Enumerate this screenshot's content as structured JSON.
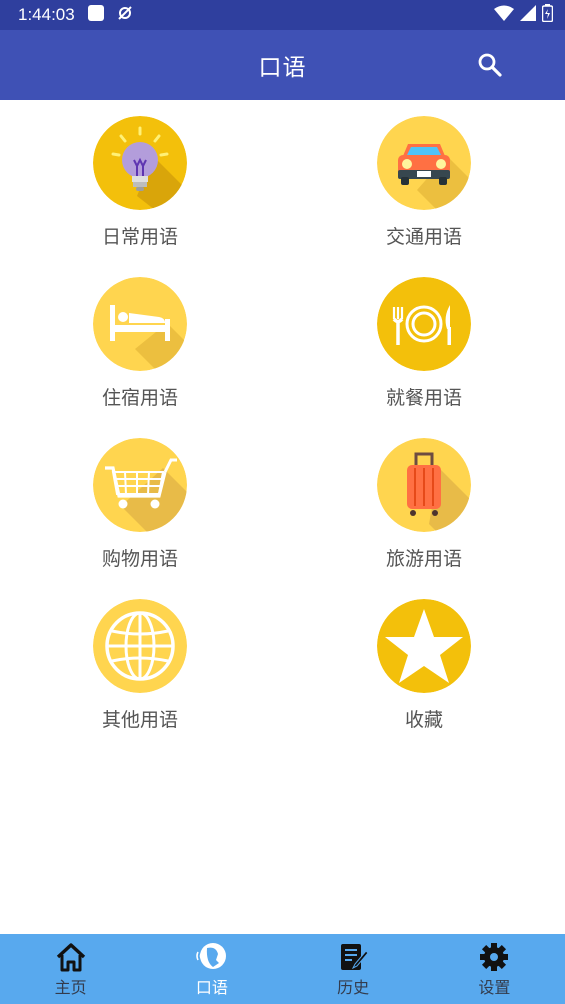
{
  "status_bar": {
    "time": "1:44:03",
    "icons": [
      "notification-square-icon",
      "sync-icon",
      "wifi-icon",
      "signal-icon",
      "battery-icon"
    ]
  },
  "app_bar": {
    "title": "口语",
    "action_icon": "search-icon"
  },
  "categories": [
    {
      "label": "日常用语",
      "icon": "lightbulb-icon"
    },
    {
      "label": "交通用语",
      "icon": "car-icon"
    },
    {
      "label": "住宿用语",
      "icon": "bed-icon"
    },
    {
      "label": "就餐用语",
      "icon": "plate-cutlery-icon"
    },
    {
      "label": "购物用语",
      "icon": "shopping-cart-icon"
    },
    {
      "label": "旅游用语",
      "icon": "suitcase-icon"
    },
    {
      "label": "其他用语",
      "icon": "globe-icon"
    },
    {
      "label": "收藏",
      "icon": "star-icon"
    }
  ],
  "bottom_nav": {
    "items": [
      {
        "label": "主页",
        "icon": "home-icon"
      },
      {
        "label": "口语",
        "icon": "speech-icon"
      },
      {
        "label": "历史",
        "icon": "history-icon"
      },
      {
        "label": "设置",
        "icon": "settings-gear-icon"
      }
    ],
    "active_index": 1
  },
  "colors": {
    "status_bar": "#2f3f9e",
    "app_bar": "#3f51b5",
    "bottom_nav": "#58a9ee",
    "icon_yellow_light": "#ffd54f",
    "icon_yellow_dark": "#f3c00b",
    "label_text": "#555555"
  }
}
